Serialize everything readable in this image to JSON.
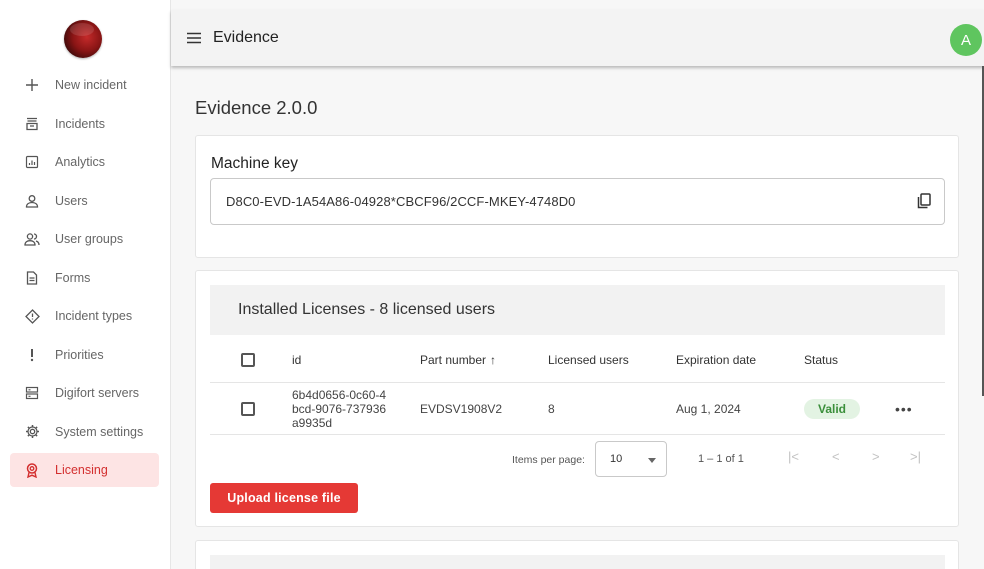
{
  "app": {
    "title": "Evidence",
    "avatar_letter": "A",
    "avatar_color": "#5fc55f",
    "accent_color": "#e53935"
  },
  "sidebar": {
    "items": [
      {
        "label": "New incident",
        "icon": "plus-icon"
      },
      {
        "label": "Incidents",
        "icon": "inbox-icon"
      },
      {
        "label": "Analytics",
        "icon": "analytics-icon"
      },
      {
        "label": "Users",
        "icon": "user-icon"
      },
      {
        "label": "User groups",
        "icon": "user-groups-icon"
      },
      {
        "label": "Forms",
        "icon": "form-icon"
      },
      {
        "label": "Incident types",
        "icon": "diamond-alert-icon"
      },
      {
        "label": "Priorities",
        "icon": "exclamation-icon"
      },
      {
        "label": "Digifort servers",
        "icon": "server-icon"
      },
      {
        "label": "System settings",
        "icon": "gear-icon"
      },
      {
        "label": "Licensing",
        "icon": "badge-icon",
        "active": true
      }
    ]
  },
  "main": {
    "page_title": "Evidence 2.0.0",
    "machine_key": {
      "label": "Machine key",
      "value": "D8C0-EVD-1A54A86-04928*CBCF96/2CCF-MKEY-4748D0",
      "copy_icon": "copy-icon"
    },
    "licenses": {
      "header": "Installed Licenses - 8 licensed users",
      "columns": {
        "id": "id",
        "part": "Part number",
        "users": "Licensed users",
        "expiration": "Expiration date",
        "status": "Status"
      },
      "sort_arrow": "↑",
      "rows": [
        {
          "id": "6b4d0656-0c60-4bcd-9076-737936a9935d",
          "part": "EVDSV1908V2",
          "users": "8",
          "expiration": "Aug 1, 2024",
          "status": "Valid",
          "more": "•••"
        }
      ],
      "paginator": {
        "items_label": "Items per page:",
        "page_size": "10",
        "range": "1 – 1 of 1",
        "first": "|<",
        "prev": "<",
        "next": ">",
        "last": ">|"
      },
      "upload_label": "Upload license file"
    }
  }
}
